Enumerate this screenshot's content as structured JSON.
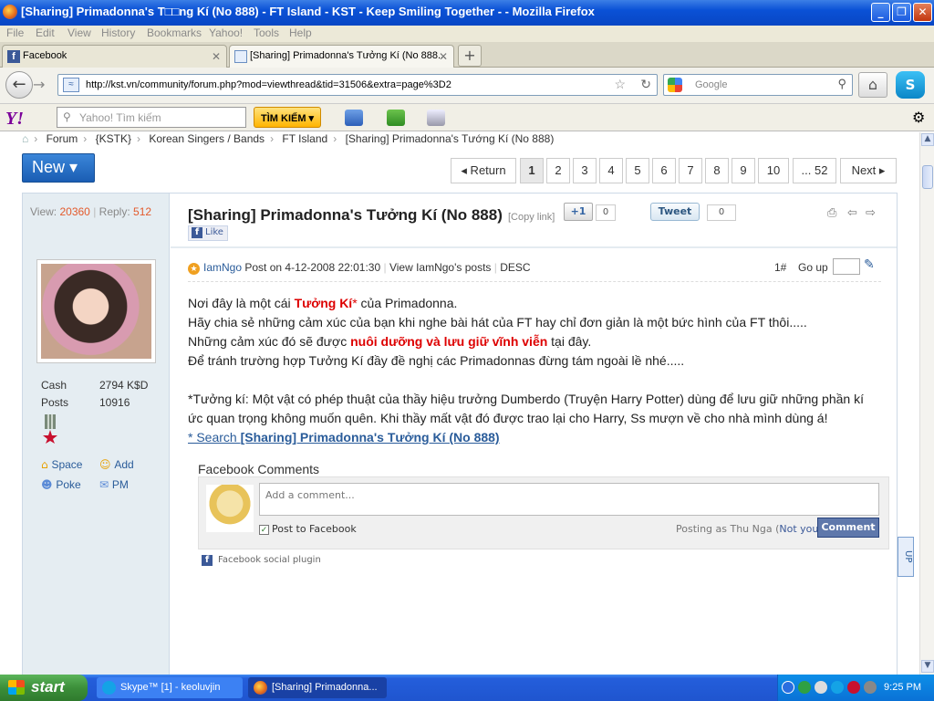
{
  "window": {
    "title": "[Sharing] Primadonna's T□□ng Kí (No 888) - FT Island - KST - Keep Smiling Together - - Mozilla Firefox",
    "controls": [
      "_",
      "❐",
      "✕"
    ]
  },
  "menu": [
    "File",
    "Edit",
    "View",
    "History",
    "Bookmarks",
    "Yahoo!",
    "Tools",
    "Help"
  ],
  "tabs": [
    {
      "label": "Facebook",
      "active": false
    },
    {
      "label": "[Sharing] Primadonna's Tưởng Kí (No 888...",
      "active": true
    }
  ],
  "new_tab": "+",
  "nav": {
    "url": "http://kst.vn/community/forum.php?mod=viewthread&tid=31506&extra=page%3D2",
    "search_placeholder": "Google"
  },
  "yahoo": {
    "logo": "Y!",
    "search_placeholder": "Yahoo! Tìm kiếm",
    "search_button": "TÌM KIẾM ▾"
  },
  "breadcrumb": [
    "Forum",
    "{KSTK}",
    "Korean Singers / Bands",
    "FT Island",
    "[Sharing] Primadonna's Tướng Kí (No 888)"
  ],
  "new_button": "New ▾",
  "pagination": {
    "return_label": "◂ Return",
    "pages": [
      "1",
      "2",
      "3",
      "4",
      "5",
      "6",
      "7",
      "8",
      "9",
      "10",
      "... 52"
    ],
    "current": "1",
    "next_label": "Next ▸"
  },
  "stats": {
    "view_label": "View:",
    "views": "20360",
    "reply_label": "Reply:",
    "replies": "512"
  },
  "user": {
    "cash_label": "Cash",
    "cash": "2794 K$D",
    "posts_label": "Posts",
    "posts": "10916",
    "links": [
      "Space",
      "Add",
      "Poke",
      "PM"
    ]
  },
  "post": {
    "title": "[Sharing] Primadonna's Tưởng Kí (No 888)",
    "copy_link": "[Copy link]",
    "gplus": "+1",
    "gplus_count": "0",
    "tweet": "Tweet",
    "tweet_count": "0",
    "like": "Like",
    "author": "IamNgo",
    "posted": "Post on 4-12-2008 22:01:30",
    "view_posts": "View IamNgo's posts",
    "order": "DESC",
    "floor": "1#",
    "go_up": "Go up",
    "lines": {
      "l1a": "Nơi đây là một cái ",
      "l1b": "Tưởng Kí",
      "l1c": "*",
      "l1d": " của Primadonna.",
      "l2": "Hãy chia sẻ những cảm xúc của bạn khi nghe bài hát của FT hay chỉ đơn giản là một bức hình của FT thôi.....",
      "l3a": "Những cảm xúc đó sẽ được ",
      "l3b": "nuôi dưỡng và lưu giữ vĩnh viễn",
      "l3c": " tại đây.",
      "l4": "Để tránh trường hợp Tưởng Kí đầy đề nghị các Primadonnas đừng tám ngoài lề nhé.....",
      "l5": "*Tưởng kí: Một vật có phép thuật của thầy hiệu trưởng Dumberdo (Truyện Harry Potter) dùng để lưu giữ những phần kí ức quan trọng không muốn quên. Khi thầy mất vật đó được trao lại cho Harry, Ss mượn về cho nhà mình dùng á!",
      "search_prefix": "* Search ",
      "search_title": "[Sharing] Primadonna's Tưởng Kí (No 888)"
    }
  },
  "facebook": {
    "header": "Facebook Comments",
    "placeholder": "Add a comment...",
    "post_to": "Post to Facebook",
    "posting_as": "Posting as Thu Nga (",
    "not_you": "Not you?",
    "posting_close": ")",
    "comment_button": "Comment",
    "plugin": "Facebook social plugin"
  },
  "up_button": "UP",
  "taskbar": {
    "start": "start",
    "tasks": [
      "Skype™ [1] - keoluvjin",
      "[Sharing] Primadonna..."
    ],
    "clock": "9:25 PM"
  }
}
